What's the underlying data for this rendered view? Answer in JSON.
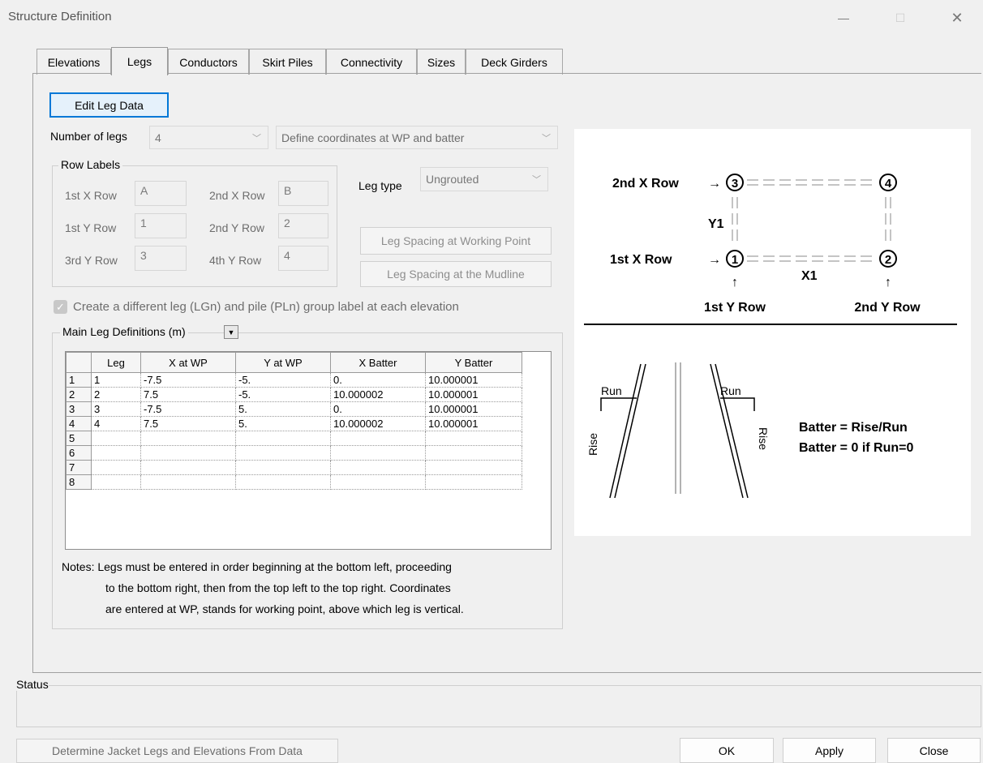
{
  "window": {
    "title": "Structure Definition",
    "minimize": "—",
    "maximize": "☐",
    "close": "✕"
  },
  "tabs": [
    {
      "label": "Elevations",
      "active": false
    },
    {
      "label": "Legs",
      "active": true
    },
    {
      "label": "Conductors",
      "active": false
    },
    {
      "label": "Skirt Piles",
      "active": false
    },
    {
      "label": "Connectivity",
      "active": false
    },
    {
      "label": "Sizes",
      "active": false
    },
    {
      "label": "Deck Girders",
      "active": false
    }
  ],
  "edit_leg_data": "Edit Leg Data",
  "number_of_legs": {
    "label": "Number of legs",
    "value": "4"
  },
  "define_mode": "Define coordinates at WP and batter",
  "row_labels": {
    "title": "Row Labels",
    "x1": {
      "label": "1st X Row",
      "value": "A"
    },
    "x2": {
      "label": "2nd X Row",
      "value": "B"
    },
    "y1": {
      "label": "1st Y Row",
      "value": "1"
    },
    "y2": {
      "label": "2nd Y Row",
      "value": "2"
    },
    "y3": {
      "label": "3rd Y Row",
      "value": "3"
    },
    "y4": {
      "label": "4th Y Row",
      "value": "4"
    }
  },
  "leg_type": {
    "label": "Leg type",
    "value": "Ungrouted"
  },
  "spacing_wp": "Leg Spacing at Working Point",
  "spacing_mudline": "Leg Spacing at the Mudline",
  "group_label_checkbox": "Create a different leg (LGn) and pile (PLn) group label at each elevation",
  "main_defs": {
    "title": "Main Leg Definitions (m)",
    "columns": [
      "Leg",
      "X at WP",
      "Y at WP",
      "X Batter",
      "Y Batter"
    ],
    "rows": [
      {
        "n": "1",
        "cells": [
          "1",
          "-7.5",
          "-5.",
          "0.",
          "10.000001"
        ]
      },
      {
        "n": "2",
        "cells": [
          "2",
          "7.5",
          "-5.",
          "10.000002",
          "10.000001"
        ]
      },
      {
        "n": "3",
        "cells": [
          "3",
          "-7.5",
          "5.",
          "0.",
          "10.000001"
        ]
      },
      {
        "n": "4",
        "cells": [
          "4",
          "7.5",
          "5.",
          "10.000002",
          "10.000001"
        ]
      },
      {
        "n": "5",
        "cells": [
          "",
          "",
          "",
          "",
          ""
        ]
      },
      {
        "n": "6",
        "cells": [
          "",
          "",
          "",
          "",
          ""
        ]
      },
      {
        "n": "7",
        "cells": [
          "",
          "",
          "",
          "",
          ""
        ]
      },
      {
        "n": "8",
        "cells": [
          "",
          "",
          "",
          "",
          ""
        ]
      }
    ]
  },
  "notes": {
    "line1": "Notes: Legs must be entered in order beginning at the bottom left, proceeding",
    "line2": "to the bottom right, then from the top left to the top right.  Coordinates",
    "line3": "are entered at WP, stands for working point, above which leg is vertical."
  },
  "diagram": {
    "x2_row": "2nd X Row",
    "x1_row": "1st X Row",
    "y1": "Y1",
    "x1": "X1",
    "y1_row": "1st Y Row",
    "y2_row": "2nd Y Row",
    "n1": "1",
    "n2": "2",
    "n3": "3",
    "n4": "4",
    "arrow": "→",
    "up_arrow": "↑",
    "run": "Run",
    "rise": "Rise",
    "batter_eq": "Batter = Rise/Run",
    "batter_zero": "Batter = 0 if Run=0"
  },
  "status": {
    "title": "Status"
  },
  "buttons": {
    "determine": "Determine Jacket Legs and Elevations From Data",
    "ok": "OK",
    "apply": "Apply",
    "close": "Close"
  }
}
